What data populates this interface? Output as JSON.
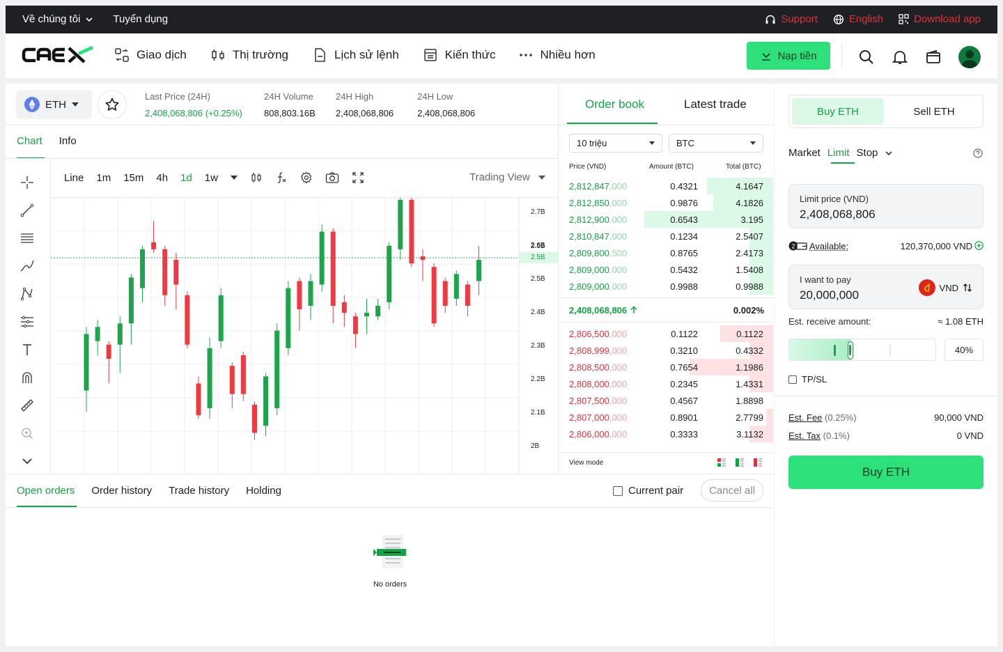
{
  "topbar": {
    "about": "Về chúng tôi",
    "careers": "Tuyển dụng",
    "support": "Support",
    "language": "English",
    "download": "Download app"
  },
  "nav": {
    "logo": "CAEX",
    "items": [
      "Giao dịch",
      "Thị trường",
      "Lịch sử lệnh",
      "Kiến thức",
      "Nhiều hơn"
    ],
    "deposit": "Nạp tiền"
  },
  "pair": {
    "symbol": "ETH",
    "stats": [
      {
        "label": "Last Price (24H)",
        "value": "2,408,068,806 (+0.25%)"
      },
      {
        "label": "24H Volume",
        "value": "808,803.16B"
      },
      {
        "label": "24H High",
        "value": "2,408,068,806"
      },
      {
        "label": "24H Low",
        "value": "2,408,068,806"
      }
    ]
  },
  "chart_tabs": [
    "Chart",
    "Info"
  ],
  "chart_toolbar": {
    "intervals": [
      "Line",
      "1m",
      "15m",
      "4h",
      "1d",
      "1w"
    ],
    "active": "1d",
    "view": "Trading View"
  },
  "chart_data": {
    "type": "candlestick",
    "y_ticks": [
      "2.7B",
      "2.6B",
      "2.5B",
      "2.5B",
      "2.4B",
      "2.3B",
      "2.2B",
      "2.1B",
      "2B"
    ],
    "current_price_label": "2.5B",
    "ylim": [
      1.98,
      2.71
    ],
    "current_price": 2.556,
    "candles": [
      {
        "o": 2.18,
        "c": 2.34,
        "h": 2.36,
        "l": 2.12
      },
      {
        "o": 2.32,
        "c": 2.36,
        "h": 2.38,
        "l": 2.28
      },
      {
        "o": 2.31,
        "c": 2.27,
        "h": 2.32,
        "l": 2.2
      },
      {
        "o": 2.31,
        "c": 2.37,
        "h": 2.39,
        "l": 2.23
      },
      {
        "o": 2.37,
        "c": 2.5,
        "h": 2.51,
        "l": 2.31
      },
      {
        "o": 2.47,
        "c": 2.58,
        "h": 2.59,
        "l": 2.43
      },
      {
        "o": 2.6,
        "c": 2.58,
        "h": 2.66,
        "l": 2.57
      },
      {
        "o": 2.58,
        "c": 2.45,
        "h": 2.59,
        "l": 2.42
      },
      {
        "o": 2.55,
        "c": 2.48,
        "h": 2.57,
        "l": 2.41
      },
      {
        "o": 2.45,
        "c": 2.31,
        "h": 2.46,
        "l": 2.3
      },
      {
        "o": 2.2,
        "c": 2.11,
        "h": 2.22,
        "l": 2.1
      },
      {
        "o": 2.13,
        "c": 2.3,
        "h": 2.33,
        "l": 2.1
      },
      {
        "o": 2.32,
        "c": 2.45,
        "h": 2.47,
        "l": 2.3
      },
      {
        "o": 2.25,
        "c": 2.17,
        "h": 2.26,
        "l": 2.13
      },
      {
        "o": 2.28,
        "c": 2.17,
        "h": 2.29,
        "l": 2.15
      },
      {
        "o": 2.14,
        "c": 2.06,
        "h": 2.15,
        "l": 2.04
      },
      {
        "o": 2.08,
        "c": 2.22,
        "h": 2.23,
        "l": 2.05
      },
      {
        "o": 2.13,
        "c": 2.35,
        "h": 2.37,
        "l": 2.11
      },
      {
        "o": 2.3,
        "c": 2.47,
        "h": 2.49,
        "l": 2.28
      },
      {
        "o": 2.49,
        "c": 2.41,
        "h": 2.5,
        "l": 2.35
      },
      {
        "o": 2.42,
        "c": 2.49,
        "h": 2.51,
        "l": 2.38
      },
      {
        "o": 2.48,
        "c": 2.63,
        "h": 2.65,
        "l": 2.46
      },
      {
        "o": 2.63,
        "c": 2.42,
        "h": 2.64,
        "l": 2.37
      },
      {
        "o": 2.43,
        "c": 2.4,
        "h": 2.45,
        "l": 2.36
      },
      {
        "o": 2.39,
        "c": 2.34,
        "h": 2.4,
        "l": 2.3
      },
      {
        "o": 2.39,
        "c": 2.4,
        "h": 2.44,
        "l": 2.34
      },
      {
        "o": 2.39,
        "c": 2.42,
        "h": 2.44,
        "l": 2.38
      },
      {
        "o": 2.43,
        "c": 2.59,
        "h": 2.6,
        "l": 2.41
      },
      {
        "o": 2.58,
        "c": 2.72,
        "h": 2.73,
        "l": 2.55
      },
      {
        "o": 2.72,
        "c": 2.54,
        "h": 2.74,
        "l": 2.53
      },
      {
        "o": 2.56,
        "c": 2.55,
        "h": 2.58,
        "l": 2.49
      },
      {
        "o": 2.53,
        "c": 2.37,
        "h": 2.54,
        "l": 2.36
      },
      {
        "o": 2.49,
        "c": 2.42,
        "h": 2.5,
        "l": 2.4
      },
      {
        "o": 2.44,
        "c": 2.51,
        "h": 2.52,
        "l": 2.42
      },
      {
        "o": 2.48,
        "c": 2.42,
        "h": 2.49,
        "l": 2.39
      },
      {
        "o": 2.49,
        "c": 2.55,
        "h": 2.59,
        "l": 2.45
      }
    ]
  },
  "orderbook": {
    "tabs": [
      "Order book",
      "Latest trade"
    ],
    "step": "10 triệu",
    "quote": "BTC",
    "headers": [
      "Price (VND)",
      "Amount (BTC)",
      "Total (BTC)"
    ],
    "asks": [
      {
        "price": "2,812,847",
        "dim": ",000",
        "amount": "0.4321",
        "total": "4.1647",
        "depth": 0.5
      },
      {
        "price": "2,812,850",
        "dim": ",000",
        "amount": "0.9876",
        "total": "4.1826",
        "depth": 0.45
      },
      {
        "price": "2,812,900",
        "dim": ",000",
        "amount": "0.6543",
        "total": "3.195",
        "depth": 0.97
      },
      {
        "price": "2,810,847",
        "dim": ",000",
        "amount": "0.1234",
        "total": "2.5407",
        "depth": 0.18
      },
      {
        "price": "2,809,800",
        "dim": ",500",
        "amount": "0.8765",
        "total": "2.4173",
        "depth": 0.18
      },
      {
        "price": "2,809,000",
        "dim": ",000",
        "amount": "0.5432",
        "total": "1.5408",
        "depth": 0.18
      },
      {
        "price": "2,809,000",
        "dim": ",000",
        "amount": "0.9988",
        "total": "0.9988",
        "depth": 0.18
      }
    ],
    "mid": {
      "price": "2,408,068,806",
      "change": "0.002%"
    },
    "bids": [
      {
        "price": "2,806,500",
        "dim": ",000",
        "amount": "0.1122",
        "total": "0.1122",
        "depth": 0.4
      },
      {
        "price": "2,808,999",
        "dim": ",000",
        "amount": "0.3210",
        "total": "0.4332",
        "depth": 0.18
      },
      {
        "price": "2,808,500",
        "dim": ",000",
        "amount": "0.7654",
        "total": "1.1986",
        "depth": 0.63
      },
      {
        "price": "2,808,000",
        "dim": ",000",
        "amount": "0.2345",
        "total": "1.4331",
        "depth": 0.18
      },
      {
        "price": "2,807,500",
        "dim": ",000",
        "amount": "0.4567",
        "total": "1.8898",
        "depth": 0
      },
      {
        "price": "2,807,000",
        "dim": ",000",
        "amount": "0.8901",
        "total": "2.7799",
        "depth": 0.05
      },
      {
        "price": "2,806,000",
        "dim": ",000",
        "amount": "0.3333",
        "total": "3.1132",
        "depth": 0.18
      }
    ],
    "view_mode": "View mode"
  },
  "orders": {
    "tabs": [
      "Open orders",
      "Order history",
      "Trade history",
      "Holding"
    ],
    "current_pair": "Current pair",
    "cancel_all": "Cancel all",
    "empty": "No orders"
  },
  "trade": {
    "buy_tab": "Buy ETH",
    "sell_tab": "Sell ETH",
    "order_types": [
      "Market",
      "Limit",
      "Stop"
    ],
    "active_type": "Limit",
    "limit_label": "Limit price (VND)",
    "limit_value": "2,408,068,806",
    "available_label": "Available:",
    "available_value": "120,370,000 VND",
    "pay_label": "I want to pay",
    "pay_value": "20,000,000",
    "pay_currency": "VND",
    "receive_label": "Est. receive amount:",
    "receive_value": "≈ 1.08 ETH",
    "slider_fraction": 0.4,
    "percent": "40%",
    "tpsl": "TP/SL",
    "fee_label": "Est. Fee",
    "fee_rate": "(0.25%)",
    "fee_value": "90,000 VND",
    "tax_label": "Est. Tax",
    "tax_rate": "(0.1%)",
    "tax_value": "0 VND",
    "buy_button": "Buy ETH"
  },
  "colors": {
    "accent": "#15a146",
    "up": "#1ea54b",
    "down": "#ee3b43",
    "button": "#2de07a"
  }
}
